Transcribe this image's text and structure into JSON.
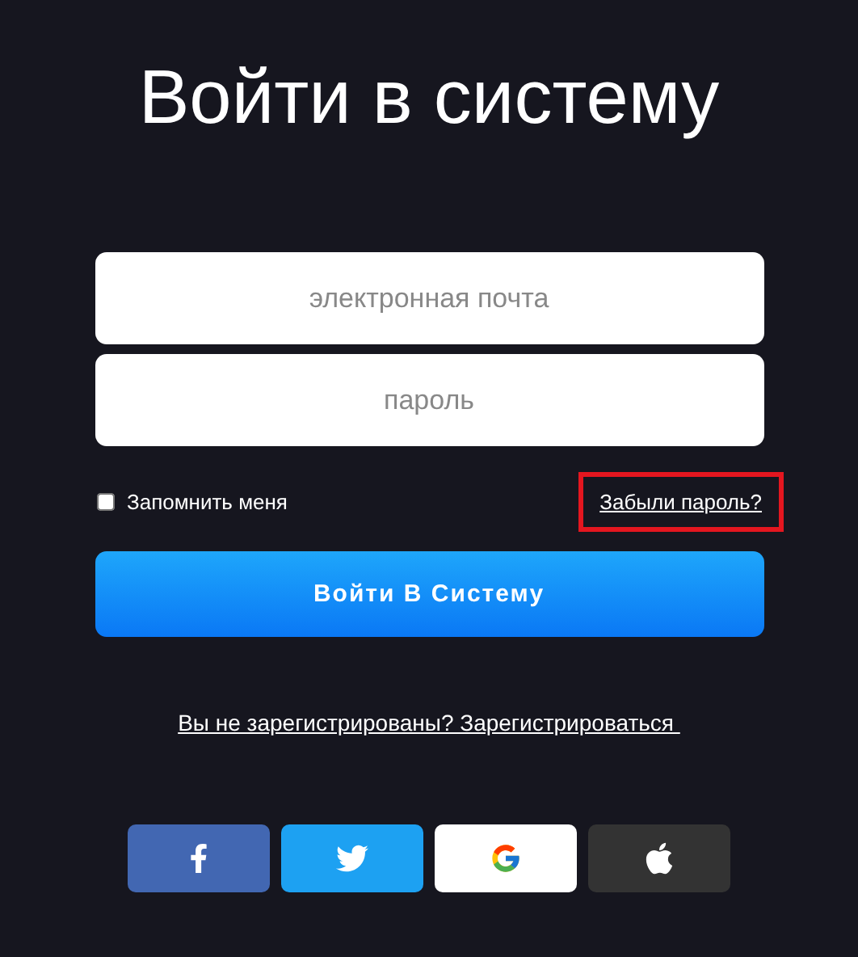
{
  "title": "Войти в систему",
  "fields": [
    {
      "placeholder": "электронная почта"
    },
    {
      "placeholder": "пароль"
    }
  ],
  "remember": {
    "label": "Запомнить меня",
    "checked": false
  },
  "forgot_link": {
    "label": "Забыли пароль?",
    "highlighted": true
  },
  "submit_button": "Войти В Систему",
  "register_link": "Вы не зарегистрированы? Зарегистрироваться ",
  "social_buttons": [
    {
      "kind": "facebook",
      "color": "#4267b2"
    },
    {
      "kind": "twitter",
      "color": "#1da1f2"
    },
    {
      "kind": "google",
      "color": "#ffffff"
    },
    {
      "kind": "apple",
      "color": "#333333"
    }
  ]
}
